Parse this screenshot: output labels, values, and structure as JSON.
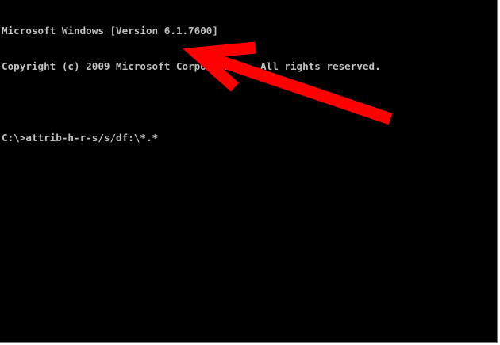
{
  "console": {
    "lines": [
      "Microsoft Windows [Version 6.1.7600]",
      "Copyright (c) 2009 Microsoft Corporation.  All rights reserved.",
      "",
      "C:\\>attrib-h-r-s/s/df:\\*.*"
    ]
  },
  "colors": {
    "background": "#000000",
    "text": "#c0c0c0",
    "annotation_arrow": "#ff0000"
  }
}
